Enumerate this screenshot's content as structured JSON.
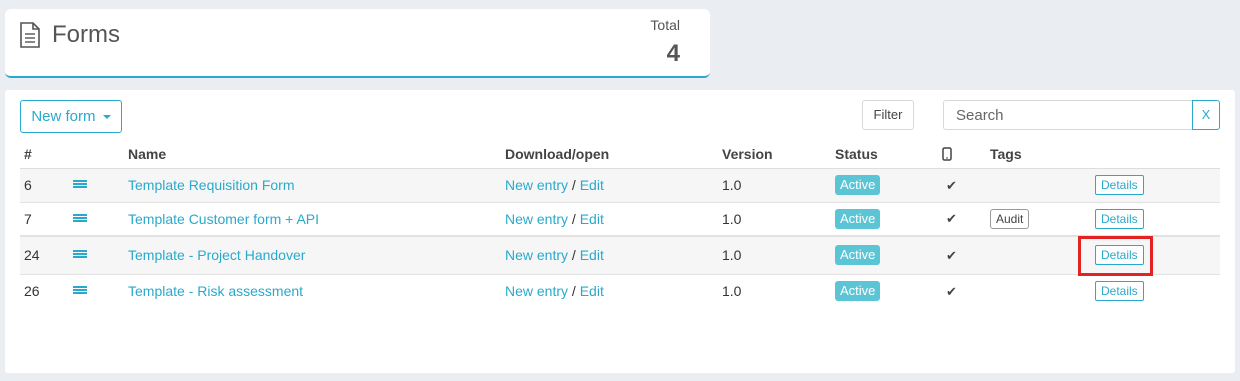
{
  "header": {
    "title": "Forms",
    "total_label": "Total",
    "total_value": "4",
    "icon": "document-icon"
  },
  "toolbar": {
    "new_form_label": "New form",
    "filter_label": "Filter",
    "search_placeholder": "Search",
    "search_value": "",
    "clear_label": "X"
  },
  "table": {
    "columns": [
      "#",
      "",
      "Name",
      "Download/open",
      "Version",
      "Status",
      "mobile-icon",
      "Tags",
      ""
    ],
    "rows": [
      {
        "id": "6",
        "name": "Template Requisition Form",
        "new_entry": "New entry",
        "edit": "Edit",
        "version": "1.0",
        "status": "Active",
        "tag": "",
        "details": "Details"
      },
      {
        "id": "7",
        "name": "Template Customer form + API",
        "new_entry": "New entry",
        "edit": "Edit",
        "version": "1.0",
        "status": "Active",
        "tag": "Audit",
        "details": "Details"
      },
      {
        "id": "24",
        "name": "Template - Project Handover",
        "new_entry": "New entry",
        "edit": "Edit",
        "version": "1.0",
        "status": "Active",
        "tag": "",
        "details": "Details"
      },
      {
        "id": "26",
        "name": "Template - Risk assessment",
        "new_entry": "New entry",
        "edit": "Edit",
        "version": "1.0",
        "status": "Active",
        "tag": "",
        "details": "Details"
      }
    ]
  },
  "colors": {
    "accent": "#2aa9cc",
    "badge": "#5bc5d6",
    "highlight": "#e32222"
  }
}
